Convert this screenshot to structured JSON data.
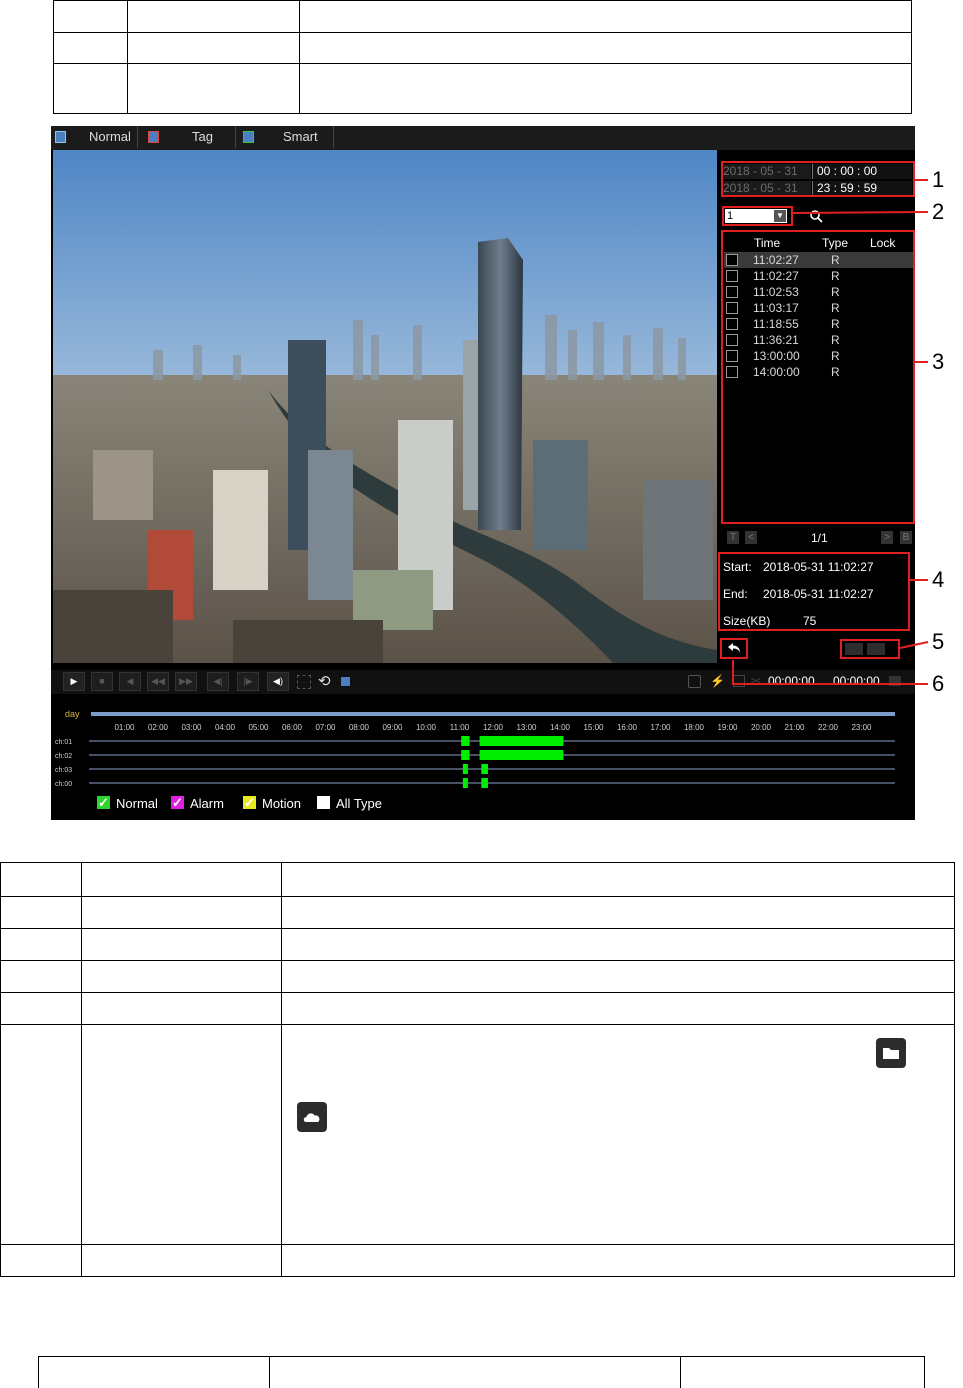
{
  "tabs": [
    {
      "label": "Normal",
      "icon": "playback-icon"
    },
    {
      "label": "Tag",
      "icon": "tag-icon"
    },
    {
      "label": "Smart",
      "icon": "smart-icon"
    }
  ],
  "search": {
    "start_date": "2018 - 05 - 31",
    "start_time": "00 : 00 : 00",
    "end_date": "2018 - 05 - 31",
    "end_time": "23 : 59 : 59",
    "channel": "1"
  },
  "list": {
    "headers": {
      "time": "Time",
      "type": "Type",
      "lock": "Lock"
    },
    "rows": [
      {
        "time": "11:02:27",
        "type": "R"
      },
      {
        "time": "11:02:27",
        "type": "R"
      },
      {
        "time": "11:02:53",
        "type": "R"
      },
      {
        "time": "11:03:17",
        "type": "R"
      },
      {
        "time": "11:18:55",
        "type": "R"
      },
      {
        "time": "11:36:21",
        "type": "R"
      },
      {
        "time": "13:00:00",
        "type": "R"
      },
      {
        "time": "14:00:00",
        "type": "R"
      }
    ],
    "page": "1/1",
    "pager_first": "T",
    "pager_prev": "<",
    "pager_next": ">",
    "pager_last": "B"
  },
  "info": {
    "start_label": "Start:",
    "start_value": "2018-05-31 11:02:27",
    "end_label": "End:",
    "end_value": "2018-05-31 11:02:27",
    "size_label": "Size(KB)",
    "size_value": "75"
  },
  "controls": {
    "current_time": "00:00:00",
    "total_time": "00:00:00"
  },
  "timeline": {
    "day_label": "day",
    "hours": [
      "01:00",
      "02:00",
      "03:00",
      "04:00",
      "05:00",
      "06:00",
      "07:00",
      "08:00",
      "09:00",
      "10:00",
      "11:00",
      "12:00",
      "13:00",
      "14:00",
      "15:00",
      "16:00",
      "17:00",
      "18:00",
      "19:00",
      "20:00",
      "21:00",
      "22:00",
      "23:00"
    ],
    "channels": [
      "ch:01",
      "ch:02",
      "ch:03",
      "ch:00"
    ],
    "segments": [
      [
        [
          11.05,
          11.3
        ],
        [
          11.6,
          14.1
        ]
      ],
      [
        [
          11.05,
          11.3
        ],
        [
          11.6,
          14.1
        ]
      ],
      [
        [
          11.1,
          11.25
        ],
        [
          11.65,
          11.85
        ]
      ],
      [
        [
          11.1,
          11.25
        ],
        [
          11.65,
          11.85
        ]
      ]
    ]
  },
  "legend": [
    {
      "label": "Normal",
      "color": "#29d629"
    },
    {
      "label": "Alarm",
      "color": "#e020e0"
    },
    {
      "label": "Motion",
      "color": "#e8e820"
    },
    {
      "label": "All Type",
      "color": "#ffffff"
    }
  ],
  "callouts": [
    "1",
    "2",
    "3",
    "4",
    "5",
    "6"
  ],
  "colors": {
    "record": "#00ee00",
    "callout": "#e02020",
    "timeline_axis": "#7a9cc9"
  }
}
